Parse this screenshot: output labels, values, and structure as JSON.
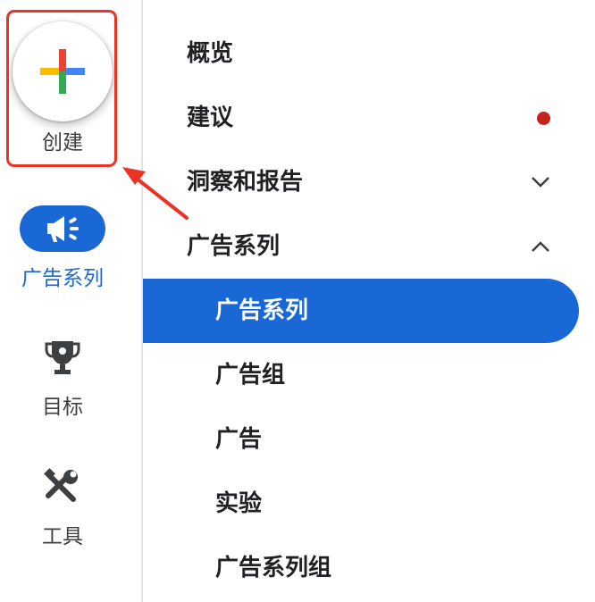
{
  "rail": {
    "create": {
      "label": "创建",
      "icon": "plus-icon"
    },
    "items": [
      {
        "label": "广告系列",
        "icon": "campaign-megaphone-icon",
        "active": true
      },
      {
        "label": "目标",
        "icon": "trophy-icon",
        "active": false
      },
      {
        "label": "工具",
        "icon": "tools-icon",
        "active": false
      }
    ]
  },
  "nav": {
    "overview": "概览",
    "recommendations": "建议",
    "insights_reports": "洞察和报告",
    "campaigns_group": "广告系列",
    "sub": {
      "campaigns": "广告系列",
      "ad_groups": "广告组",
      "ads": "广告",
      "experiments": "实验",
      "campaign_groups": "广告系列组"
    }
  },
  "colors": {
    "accent": "#1a68d6",
    "notification_dot": "#c5221f",
    "annotation": "#ea3323",
    "plus_red": "#ea4335",
    "plus_blue": "#4285f4",
    "plus_green": "#34a853",
    "plus_yellow": "#fbbc04"
  }
}
